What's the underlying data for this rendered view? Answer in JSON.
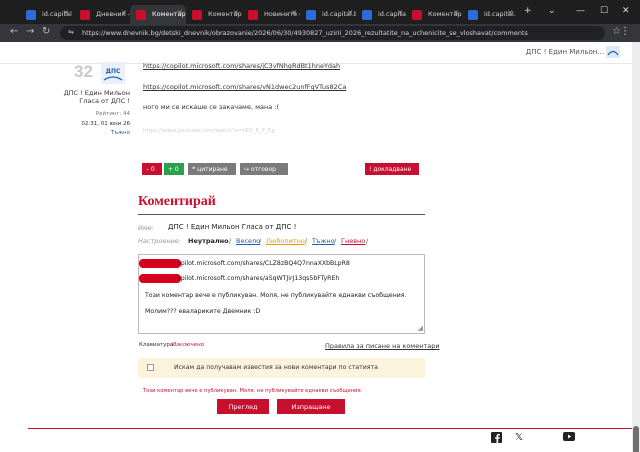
{
  "browser": {
    "tabs": [
      {
        "title": "id.capital.bg Tı",
        "color": "#2b6cd8",
        "active": false
      },
      {
        "title": "Дневник - Нов",
        "color": "#c8102e",
        "active": false
      },
      {
        "title": "Коментари",
        "color": "#c8102e",
        "active": true
      },
      {
        "title": "Коментари - Г",
        "color": "#c8102e",
        "active": false
      },
      {
        "title": "Новините от д",
        "color": "#c8102e",
        "active": false
      },
      {
        "title": "id.capital.bg |",
        "color": "#2b6cd8",
        "active": false
      },
      {
        "title": "id.capital.bg |",
        "color": "#2b6cd8",
        "active": false
      },
      {
        "title": "Коментари - I",
        "color": "#c8102e",
        "active": false
      },
      {
        "title": "id.capital.bg |",
        "color": "#2b6cd8",
        "active": false
      }
    ],
    "new_tab": "+",
    "url": "https://www.dnevnik.bg/detski_dnevnik/obrazovanie/2026/06/30/4930827_uzirii_2026_rezultatite_na_uchenicite_se_vloshavat/comments"
  },
  "header": {
    "user_name": "ДПС ! Един Мильон..."
  },
  "previous_comment": {
    "number": "32",
    "logo_text": "ДПС",
    "author": "ДПС ! Един Мильон Гласа от ДПС !",
    "rating": "Рейтинг: 44",
    "date": "02:31, 01 юни 26",
    "me": "Тъжно",
    "lines": [
      "https://copilot.microsoft.com/shares/jC3vfNhgRdBt1hneYdah",
      "https://copilot.microsoft.com/shares/vN1dwec2unfFqVTus82Ca",
      "ного ми се искаше се закачаме, мана :(",
      "https://www.youtube.com/watch?v=iiEX_E_F_Eg"
    ],
    "minus_label": "– 0",
    "plus_label": "+ 0",
    "quote_label": "цитиране",
    "answer_label": "отговор",
    "report_label": "докладване"
  },
  "form": {
    "title": "Коментирай",
    "name_label": "Име:",
    "name_value": "ДПС ! Един Мильон Гласа от ДПС !",
    "mood_label": "Настроение:",
    "moods": {
      "neutral": "Неутрално",
      "happy": "Весело",
      "curious": "Любопитно",
      "sad": "Тъжно",
      "angry": "Гневно"
    },
    "text_lines": [
      "opilot.microsoft.com/shares/CLZ8zBQ4Q7nnaXXbBLpR8",
      "opilot.microsoft.com/shares/aSqWTJirJ13qs5bFTyREh",
      "Този коментар вече е публикуван. Моля, не публикувайте еднакви съобщения.",
      "Молим??? евалариките Двемник :D"
    ],
    "keyboard_label": "Клавиатура:",
    "keyboard_value": "Изключено",
    "rules_link": "Правила за писане на коментари",
    "notify_label": "Искам да получавам известия за нови коментари по статията",
    "published_note": "Този коментар вече е публикуван. Моля, не публикувайте еднакви съобщения.",
    "preview_label": "Преглед",
    "send_label": "Изпращане"
  },
  "colors": {
    "brand_red": "#c8102e",
    "link_blue": "#1a5fb4",
    "plus_green": "#2aa14a"
  }
}
